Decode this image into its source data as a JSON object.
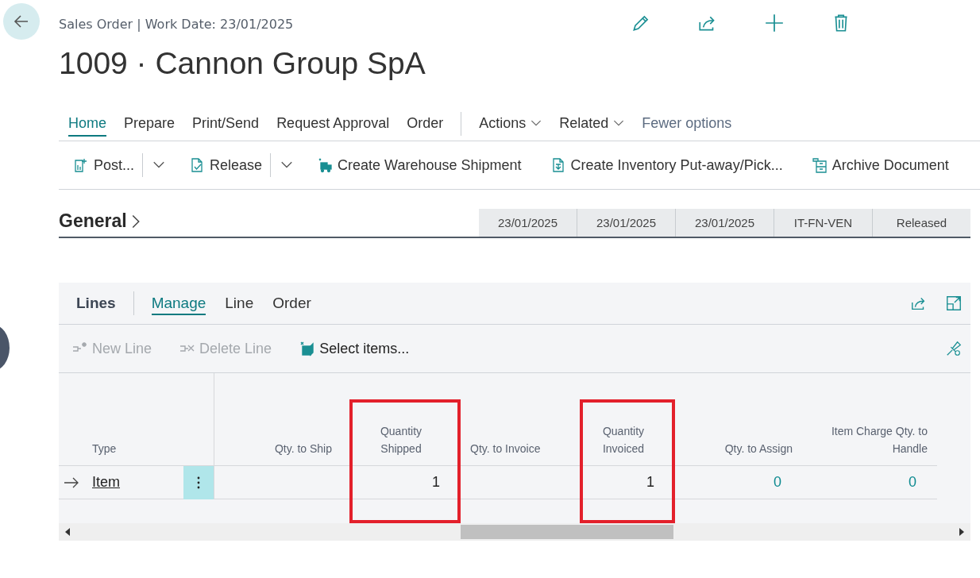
{
  "header": {
    "breadcrumb": "Sales Order | Work Date: 23/01/2025",
    "title": "1009 · Cannon Group SpA",
    "actions": [
      {
        "kind": "edit"
      },
      {
        "kind": "share"
      },
      {
        "kind": "new"
      },
      {
        "kind": "delete"
      }
    ]
  },
  "tabs": [
    {
      "label": "Home",
      "selected": true
    },
    {
      "label": "Prepare",
      "selected": false
    },
    {
      "label": "Print/Send",
      "selected": false
    },
    {
      "label": "Request Approval",
      "selected": false
    },
    {
      "label": "Order",
      "selected": false
    }
  ],
  "menus": [
    {
      "label": "Actions"
    },
    {
      "label": "Related"
    }
  ],
  "fewer_options": "Fewer options",
  "actions": [
    {
      "label": "Post...",
      "kind": "post",
      "split": true
    },
    {
      "label": "Release",
      "kind": "release",
      "split": true
    },
    {
      "label": "Create Warehouse Shipment",
      "kind": "warehouse",
      "split": false
    },
    {
      "label": "Create Inventory Put-away/Pick...",
      "kind": "inventory",
      "split": false
    },
    {
      "label": "Archive Document",
      "kind": "archive",
      "split": false
    }
  ],
  "general": {
    "title": "General",
    "summary": [
      "23/01/2025",
      "23/01/2025",
      "23/01/2025",
      "IT-FN-VEN",
      "Released"
    ]
  },
  "lines": {
    "title": "Lines",
    "tabs": [
      {
        "label": "Manage",
        "selected": true
      },
      {
        "label": "Line",
        "selected": false
      },
      {
        "label": "Order",
        "selected": false
      }
    ],
    "actions": [
      {
        "label": "New Line",
        "kind": "new",
        "disabled": true
      },
      {
        "label": "Delete Line",
        "kind": "delete",
        "disabled": true
      },
      {
        "label": "Select items...",
        "kind": "select",
        "disabled": false
      }
    ],
    "columns": [
      {
        "header": "Qty. to Ship"
      },
      {
        "header": "Quantity Shipped",
        "value": "1",
        "drilldown": false,
        "highlighted": true
      },
      {
        "header": "Qty. to Invoice"
      },
      {
        "header": "Quantity Invoiced",
        "value": "1",
        "drilldown": false,
        "highlighted": true
      },
      {
        "header": "Qty. to Assign",
        "value": "0",
        "drilldown": true
      },
      {
        "header": "Item Charge Qty. to Handle",
        "value": "0",
        "drilldown": true
      }
    ],
    "type_header": "Type",
    "row": {
      "type": "Item",
      "current": true
    }
  }
}
